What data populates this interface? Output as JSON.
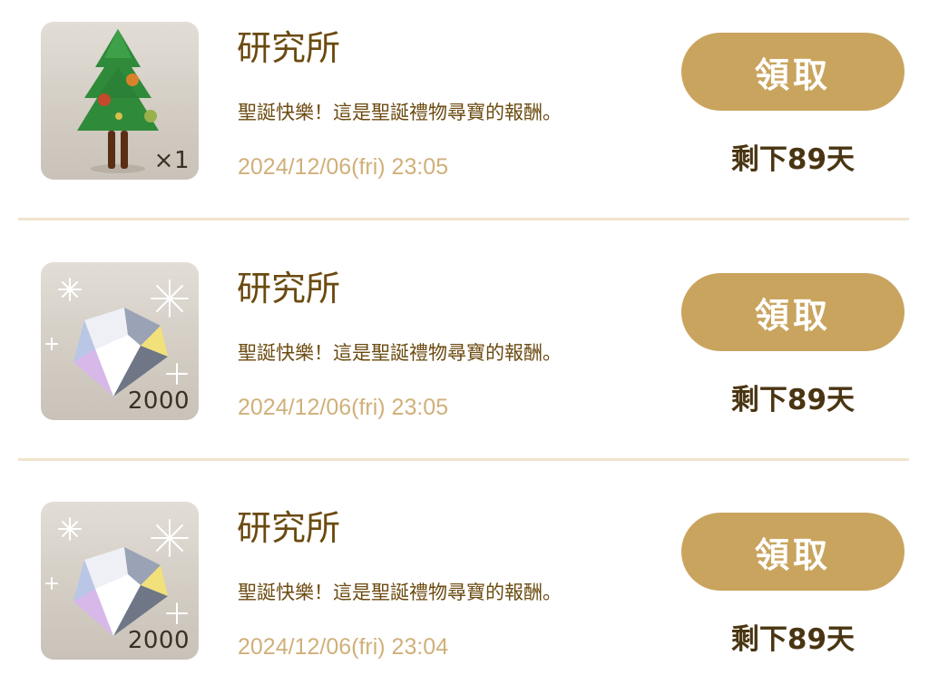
{
  "mail_items": [
    {
      "icon": "christmas-tree-icon",
      "quantity": "×1",
      "sender": "研究所",
      "message": "聖誕快樂！這是聖誕禮物尋寶的報酬。",
      "timestamp": "2024/12/06(fri) 23:05",
      "claim_label": "領取",
      "expiry": "剩下89天"
    },
    {
      "icon": "diamond-icon",
      "quantity": "2000",
      "sender": "研究所",
      "message": "聖誕快樂！這是聖誕禮物尋寶的報酬。",
      "timestamp": "2024/12/06(fri) 23:05",
      "claim_label": "領取",
      "expiry": "剩下89天"
    },
    {
      "icon": "diamond-icon",
      "quantity": "2000",
      "sender": "研究所",
      "message": "聖誕快樂！這是聖誕禮物尋寶的報酬。",
      "timestamp": "2024/12/06(fri) 23:04",
      "claim_label": "領取",
      "expiry": "剩下89天"
    }
  ],
  "colors": {
    "button_gold": "#c9a45e",
    "sender_brown": "#6b4a10",
    "timestamp_tan": "#d0b07a",
    "divider": "#f1e4cd"
  }
}
